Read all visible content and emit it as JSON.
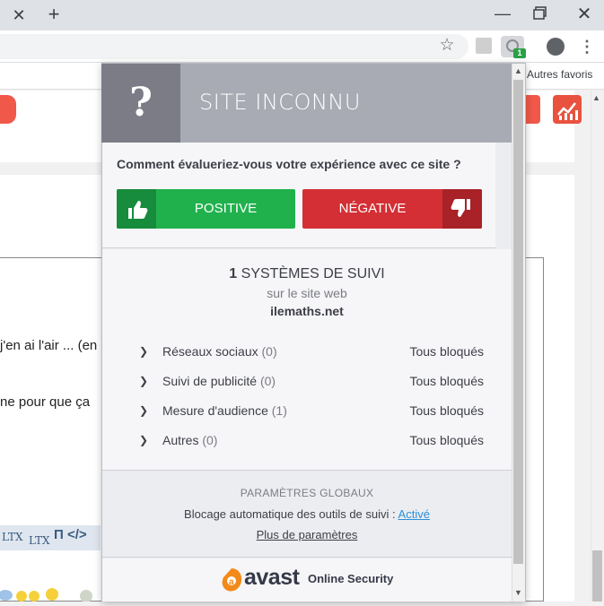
{
  "browser": {
    "tab_close_glyph": "✕",
    "new_tab_glyph": "+",
    "window_min_glyph": "—",
    "window_close_glyph": "✕",
    "bookmark_other": "Autres favoris",
    "extension_badge": "1",
    "menu_glyph": "⋮",
    "star_glyph": "☆"
  },
  "page": {
    "text_line_1": "j'en ai l'air ... (en",
    "text_line_2": "ne pour que ça",
    "latex_1": "LTX",
    "latex_2": "LTX",
    "latex_3": "Π </>"
  },
  "popup": {
    "header": {
      "icon_glyph": "?",
      "title": "SITE INCONNU"
    },
    "rating": {
      "question": "Comment évalueriez-vous votre expérience avec ce site ?",
      "positive_label": "POSITIVE",
      "negative_label": "NÉGATIVE"
    },
    "tracking": {
      "count": "1",
      "count_label": "SYSTÈMES DE SUIVI",
      "subtitle": "sur le site web",
      "domain": "ilemaths.net",
      "rows": [
        {
          "name": "Réseaux sociaux",
          "count": "(0)",
          "status": "Tous bloqués"
        },
        {
          "name": "Suivi de publicité",
          "count": "(0)",
          "status": "Tous bloqués"
        },
        {
          "name": "Mesure d'audience",
          "count": "(1)",
          "status": "Tous bloqués"
        },
        {
          "name": "Autres",
          "count": "(0)",
          "status": "Tous bloqués"
        }
      ]
    },
    "global": {
      "title": "PARAMÈTRES GLOBAUX",
      "auto_block_label": "Blocage automatique des outils de suivi :",
      "auto_block_value": "Activé",
      "more_settings": "Plus de paramètres"
    },
    "footer": {
      "brand": "avast",
      "product": "Online Security"
    }
  },
  "colors": {
    "positive": "#20b14d",
    "negative": "#d32f35",
    "header_band": "#a8aab4",
    "header_icon_bg": "#7b7c86",
    "link": "#2c8fd8",
    "avast_orange": "#f28a1a"
  }
}
